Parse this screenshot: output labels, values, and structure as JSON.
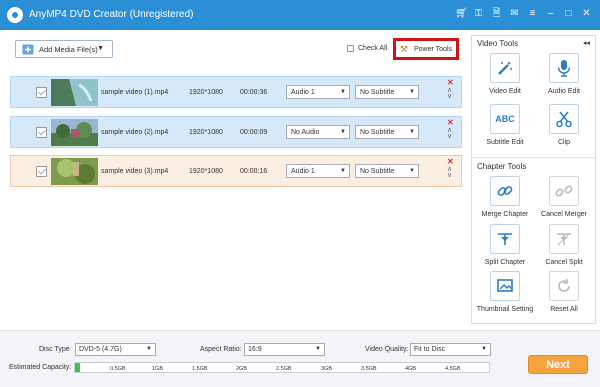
{
  "app": {
    "title": "AnyMP4 DVD Creator (Unregistered)"
  },
  "toolbar": {
    "add_media_label": "Add Media File(s)",
    "check_all_label": "Check All",
    "power_tools_label": "Power Tools"
  },
  "files": [
    {
      "name": "sample video (1).mp4",
      "resolution": "1920*1080",
      "duration": "00:00:36",
      "audio": "Audio 1",
      "subtitle": "No Subtitle",
      "selected": false
    },
    {
      "name": "sample video (2).mp4",
      "resolution": "1920*1080",
      "duration": "00:00:09",
      "audio": "No Audio",
      "subtitle": "No Subtitle",
      "selected": false
    },
    {
      "name": "sample video (3).mp4",
      "resolution": "1920*1080",
      "duration": "00:00:16",
      "audio": "Audio 1",
      "subtitle": "No Subtitle",
      "selected": true
    }
  ],
  "video_tools": {
    "heading": "Video Tools",
    "items": [
      {
        "label": "Video Edit",
        "icon": "magic-wand-icon",
        "enabled": true
      },
      {
        "label": "Audio Edit",
        "icon": "microphone-icon",
        "enabled": true
      },
      {
        "label": "Subtitle Edit",
        "icon": "abc-icon",
        "enabled": true
      },
      {
        "label": "Clip",
        "icon": "scissors-icon",
        "enabled": true
      }
    ]
  },
  "chapter_tools": {
    "heading": "Chapter Tools",
    "items": [
      {
        "label": "Merge Chapter",
        "icon": "link-icon",
        "enabled": true
      },
      {
        "label": "Cancel Merger",
        "icon": "broken-link-icon",
        "enabled": false
      },
      {
        "label": "Split Chapter",
        "icon": "split-icon",
        "enabled": true
      },
      {
        "label": "Cancel Split",
        "icon": "cancel-split-icon",
        "enabled": false
      },
      {
        "label": "Thumbnail Setting",
        "icon": "thumbnail-icon",
        "enabled": true
      },
      {
        "label": "Reset All",
        "icon": "reset-icon",
        "enabled": false
      }
    ]
  },
  "settings": {
    "disc_type_label": "Disc Type",
    "disc_type_value": "DVD-5 (4.7G)",
    "aspect_ratio_label": "Aspect Ratio:",
    "aspect_ratio_value": "16:9",
    "video_quality_label": "Video Quality:",
    "video_quality_value": "Fit to Disc",
    "capacity_label": "Estimated Capacity:",
    "capacity_fill_fraction": 0.012,
    "capacity_ticks": [
      "0.5GB",
      "1GB",
      "1.5GB",
      "2GB",
      "2.5GB",
      "3GB",
      "3.5GB",
      "4GB",
      "4.5GB"
    ]
  },
  "next_label": "Next",
  "colors": {
    "titlebar": "#2b8fd6",
    "accent": "#f5a33f",
    "highlight_box": "#c81515",
    "row": "#d6e9f8",
    "row_selected": "#fbeee3"
  }
}
